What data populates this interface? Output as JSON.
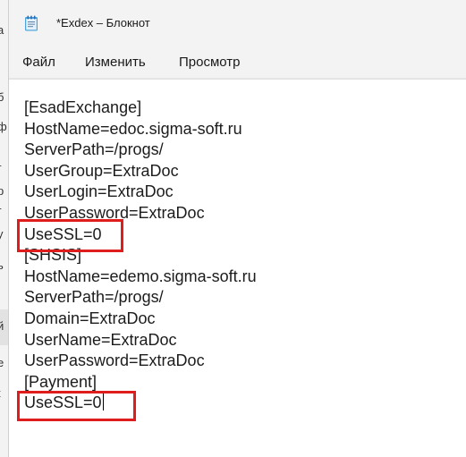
{
  "window": {
    "title": "*Exdex – Блокнот",
    "icon": "notepad-icon"
  },
  "menu": {
    "items": [
      {
        "label": "Файл"
      },
      {
        "label": "Изменить"
      },
      {
        "label": "Просмотр"
      }
    ]
  },
  "editor": {
    "lines": [
      "[EsadExchange]",
      "HostName=edoc.sigma-soft.ru",
      "ServerPath=/progs/",
      "UserGroup=ExtraDoc",
      "UserLogin=ExtraDoc",
      "UserPassword=ExtraDoc",
      "UseSSL=0",
      "[SHSIS]",
      "HostName=edemo.sigma-soft.ru",
      "ServerPath=/progs/",
      "Domain=ExtraDoc",
      "UserName=ExtraDoc",
      "UserPassword=ExtraDoc",
      "[Payment]",
      "UseSSL=0"
    ],
    "highlighted_lines": [
      "UseSSL=0",
      "UseSSL=0"
    ],
    "highlight_color": "#e01d1d"
  },
  "background_window": {
    "fragments": [
      "a",
      "б",
      "ф",
      "г",
      "р",
      "г",
      "у",
      "ь",
      "й",
      "e",
      "t"
    ]
  }
}
